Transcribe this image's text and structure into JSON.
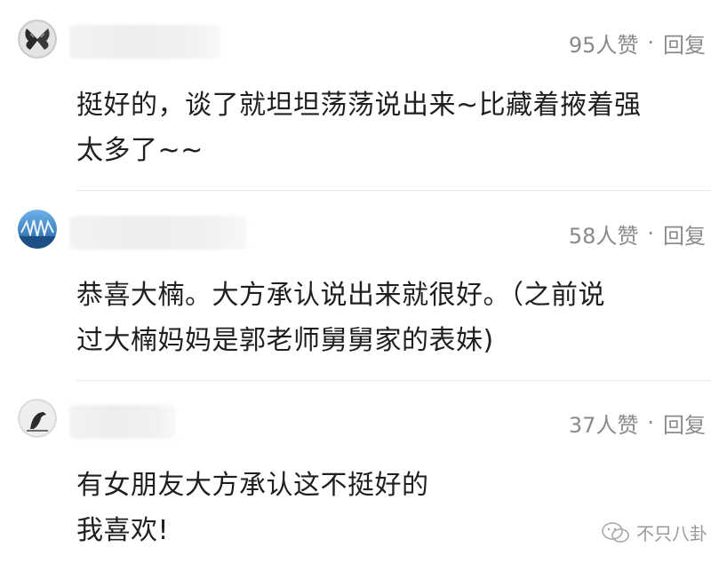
{
  "comments": [
    {
      "avatar": "butterfly-avatar",
      "likes": "95人赞",
      "separator": "·",
      "reply": "回复",
      "lines": [
        "挺好的，谈了就坦坦荡荡说出来~比藏着掖着强",
        "太多了~~"
      ]
    },
    {
      "avatar": "blue-pattern-avatar",
      "likes": "58人赞",
      "separator": "·",
      "reply": "回复",
      "lines": [
        "恭喜大楠。大方承认说出来就很好。（之前说",
        "过大楠妈妈是郭老师舅舅家的表妹)"
      ]
    },
    {
      "avatar": "bird-avatar",
      "likes": "37人赞",
      "separator": "·",
      "reply": "回复",
      "lines": [
        "有女朋友大方承认这不挺好的",
        "我喜欢!"
      ]
    }
  ],
  "watermark": {
    "icon": "wechat-logo-icon",
    "text": "不只八卦"
  }
}
